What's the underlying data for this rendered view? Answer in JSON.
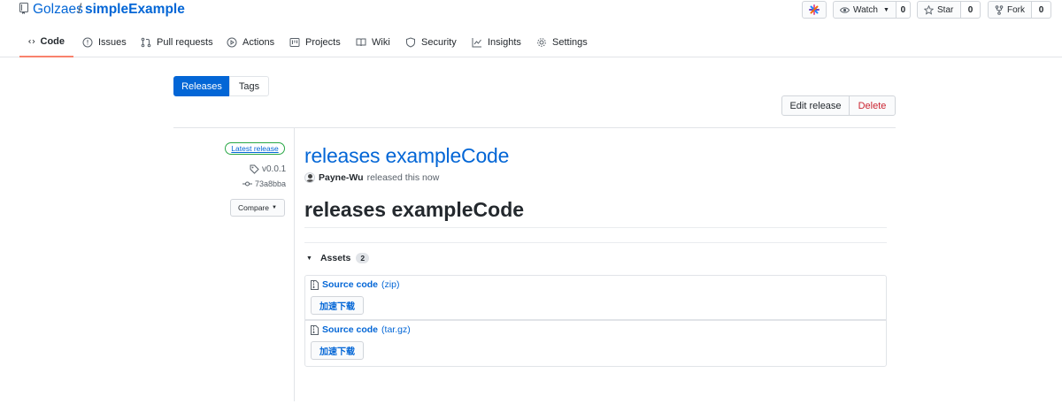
{
  "repo": {
    "owner": "Golzaes",
    "separator": "/",
    "name": "simpleExample"
  },
  "header_buttons": {
    "watch": {
      "label": "Watch",
      "count": "0"
    },
    "star": {
      "label": "Star",
      "count": "0"
    },
    "fork": {
      "label": "Fork",
      "count": "0"
    }
  },
  "tabs": [
    {
      "label": "Code",
      "icon": "code-icon",
      "active": true
    },
    {
      "label": "Issues",
      "icon": "issue-icon"
    },
    {
      "label": "Pull requests",
      "icon": "pull-request-icon"
    },
    {
      "label": "Actions",
      "icon": "play-icon"
    },
    {
      "label": "Projects",
      "icon": "project-icon"
    },
    {
      "label": "Wiki",
      "icon": "book-icon"
    },
    {
      "label": "Security",
      "icon": "shield-icon"
    },
    {
      "label": "Insights",
      "icon": "graph-icon"
    },
    {
      "label": "Settings",
      "icon": "gear-icon"
    }
  ],
  "subnav": {
    "releases": "Releases",
    "tags": "Tags"
  },
  "actions": {
    "edit": "Edit release",
    "delete": "Delete"
  },
  "release": {
    "badge": "Latest release",
    "tag": "v0.0.1",
    "commit": "73a8bba",
    "compare": "Compare",
    "title": "releases exampleCode",
    "author": "Payne-Wu",
    "released_text": "released this now",
    "body_heading": "releases exampleCode"
  },
  "assets": {
    "label": "Assets",
    "count": "2",
    "items": [
      {
        "name": "Source code",
        "ext": "(zip)",
        "button": "加速下载"
      },
      {
        "name": "Source code",
        "ext": "(tar.gz)",
        "button": "加速下载"
      }
    ]
  },
  "colors": {
    "link": "#0366d6",
    "primary": "#0366d6",
    "danger": "#cb2431",
    "latest": "#28a745",
    "active_tab": "#f9826c"
  }
}
